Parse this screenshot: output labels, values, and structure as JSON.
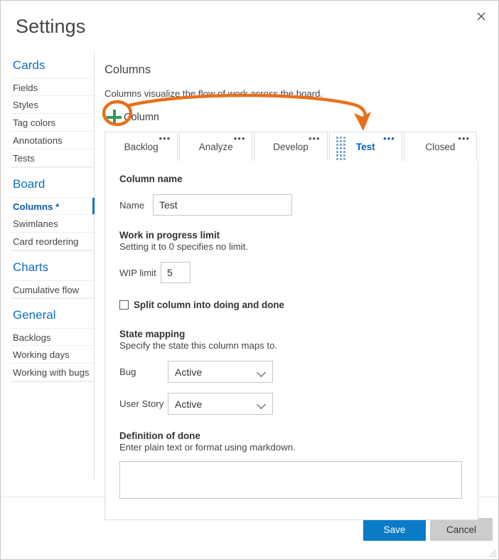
{
  "window": {
    "title": "Settings",
    "close_icon": "close-icon"
  },
  "sidebar": {
    "groups": [
      {
        "title": "Cards",
        "items": [
          {
            "label": "Fields",
            "active": false
          },
          {
            "label": "Styles",
            "active": false
          },
          {
            "label": "Tag colors",
            "active": false
          },
          {
            "label": "Annotations",
            "active": false
          },
          {
            "label": "Tests",
            "active": false
          }
        ]
      },
      {
        "title": "Board",
        "items": [
          {
            "label": "Columns *",
            "active": true
          },
          {
            "label": "Swimlanes",
            "active": false
          },
          {
            "label": "Card reordering",
            "active": false
          }
        ]
      },
      {
        "title": "Charts",
        "items": [
          {
            "label": "Cumulative flow",
            "active": false
          }
        ]
      },
      {
        "title": "General",
        "items": [
          {
            "label": "Backlogs",
            "active": false
          },
          {
            "label": "Working days",
            "active": false
          },
          {
            "label": "Working with bugs",
            "active": false
          }
        ]
      }
    ]
  },
  "main": {
    "section_title": "Columns",
    "section_description": "Columns visualize the flow of work across the board.",
    "add_column_label": "Column",
    "add_column_icon": "plus-icon",
    "tabs": [
      {
        "label": "Backlog",
        "active": false,
        "menu": "•••"
      },
      {
        "label": "Analyze",
        "active": false,
        "menu": "•••"
      },
      {
        "label": "Develop",
        "active": false,
        "menu": "•••"
      },
      {
        "label": "Test",
        "active": true,
        "menu": "•••"
      },
      {
        "label": "Closed",
        "active": false,
        "menu": "•••"
      }
    ],
    "panel": {
      "column_name_heading": "Column name",
      "name_label": "Name",
      "name_value": "Test",
      "name_placeholder": "",
      "wip_heading": "Work in progress limit",
      "wip_sub": "Setting it to 0 specifies no limit.",
      "wip_label": "WIP limit",
      "wip_value": "5",
      "split_label": "Split column into doing and done",
      "split_checked": false,
      "state_heading": "State mapping",
      "state_sub": "Specify the state this column maps to.",
      "bug_label": "Bug",
      "bug_value": "Active",
      "story_label": "User Story",
      "story_value": "Active",
      "dod_heading": "Definition of done",
      "dod_sub": "Enter plain text or format using markdown.",
      "dod_value": "",
      "dod_placeholder": ""
    }
  },
  "footer": {
    "save_label": "Save",
    "cancel_label": "Cancel",
    "resize_grip_icon": "resize-grip-icon"
  },
  "annotation": {
    "highlight_icon": "orange-ellipse-highlight",
    "arrow_icon": "orange-curved-arrow",
    "color": "#E8701A"
  },
  "colors": {
    "accent_blue": "#0a7bc6",
    "link_blue": "#106ebe",
    "plus_green": "#2e9b57",
    "annotation_orange": "#E8701A",
    "cancel_gray": "#cccccc"
  }
}
